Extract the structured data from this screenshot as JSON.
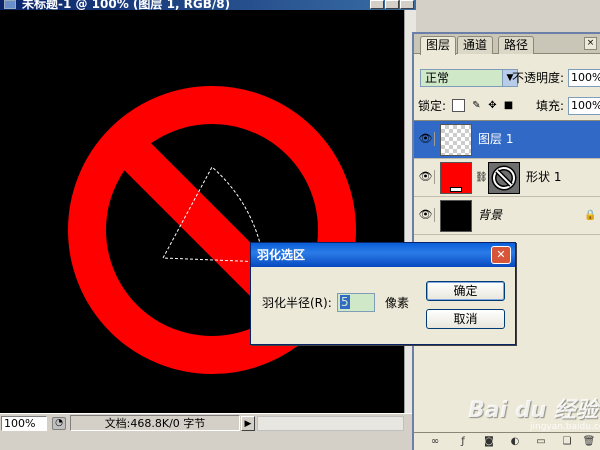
{
  "document": {
    "title": "未标题-1 @ 100% (图层 1, RGB/8)",
    "zoom": "100%",
    "info": "文档:468.8K/0 字节"
  },
  "layers_panel": {
    "tabs": [
      "图层",
      "通道",
      "路径"
    ],
    "active_tab": 0,
    "blend_mode": "正常",
    "opacity_label": "不透明度:",
    "opacity_value": "100%",
    "lock_label": "锁定:",
    "fill_label": "填充:",
    "fill_value": "100%",
    "layers": [
      {
        "name": "图层 1",
        "selected": true,
        "thumb": "transparent"
      },
      {
        "name": "形状 1",
        "selected": false,
        "thumb": "red-shape-with-vector-mask"
      },
      {
        "name": "背景",
        "selected": false,
        "thumb": "black",
        "locked": true
      }
    ]
  },
  "dialog": {
    "title": "羽化选区",
    "radius_label": "羽化半径(R):",
    "radius_value": "5",
    "unit": "像素",
    "ok": "确定",
    "cancel": "取消"
  },
  "canvas": {
    "shape": "prohibition-sign",
    "shape_color": "#ff0000",
    "background_color": "#000000"
  },
  "watermark": {
    "brand": "Bai du 经验",
    "sub": "jingyan.baidu.com"
  }
}
